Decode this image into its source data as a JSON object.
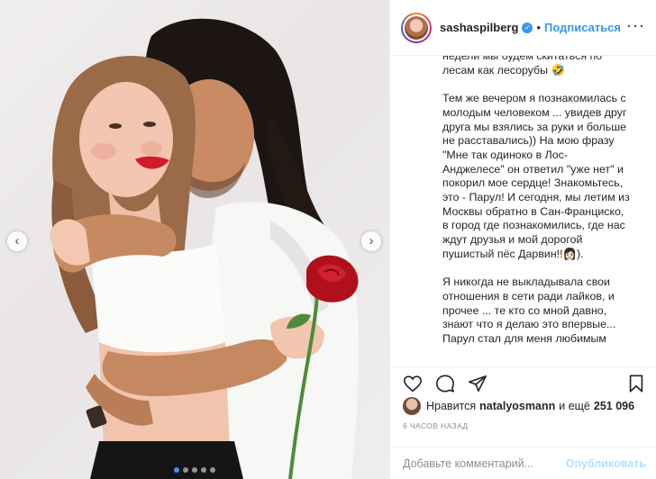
{
  "post": {
    "photo_alt": "",
    "carousel": {
      "total_slides": 5,
      "active_slide": 1
    },
    "prev_glyph": "‹",
    "next_glyph": "›"
  },
  "header": {
    "username": "sashaspilberg",
    "separator": "•",
    "follow_label": "Подписаться",
    "more_glyph": "···",
    "verified_glyph": "✓"
  },
  "caption": {
    "paragraphs": [
      "недели мы будем скитаться по\nлесам как лесорубы 🤣",
      "Тем же вечером я познакомилась с\nмолодым человеком ... увидев друг\nдруга мы взялись за руки и больше\nне расставались)) На мою фразу\n\"Мне так одиноко в Лос-\nАнджелесе\" он ответил \"уже нет\" и\nпокорил мое сердце! Знакомьтесь,\nэто - Парул! И сегодня, мы летим из\nМосквы обратно в Сан-Франциско,\nв город где познакомились, где нас\nждут друзья и мой дорогой\nпушистый пёс Дарвин!!👩🏻).",
      "Я никогда не выкладывала свои\nотношения в сети ради лайков, и\nпрочее ... те кто со мной давно,\nзнают что я делаю это впервые...\nПарул стал для меня любимым"
    ]
  },
  "actions": {
    "like_icon": "heart-icon",
    "comment_icon": "comment-icon",
    "share_icon": "share-icon",
    "save_icon": "bookmark-icon"
  },
  "likes": {
    "prefix": "Нравится",
    "user": "natalyosmann",
    "middle": "и ещё",
    "count": "251 096"
  },
  "timestamp": "6 часов назад",
  "comment_box": {
    "placeholder": "Добавьте комментарий...",
    "publish_label": "Опубликовать"
  },
  "colors": {
    "accent": "#3897f0",
    "publish_disabled": "#b2dffc",
    "muted": "#8e8e8e",
    "lipstick": "#d41a2a",
    "rose": "#b0101c"
  }
}
